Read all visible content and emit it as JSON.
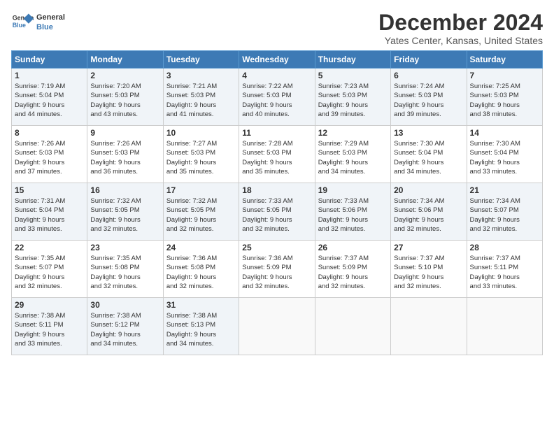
{
  "logo": {
    "name": "General Blue",
    "line1": "General",
    "line2": "Blue"
  },
  "title": "December 2024",
  "location": "Yates Center, Kansas, United States",
  "weekdays": [
    "Sunday",
    "Monday",
    "Tuesday",
    "Wednesday",
    "Thursday",
    "Friday",
    "Saturday"
  ],
  "weeks": [
    [
      {
        "day": "1",
        "sunrise": "7:19 AM",
        "sunset": "5:04 PM",
        "daylight": "9 hours and 44 minutes."
      },
      {
        "day": "2",
        "sunrise": "7:20 AM",
        "sunset": "5:03 PM",
        "daylight": "9 hours and 43 minutes."
      },
      {
        "day": "3",
        "sunrise": "7:21 AM",
        "sunset": "5:03 PM",
        "daylight": "9 hours and 41 minutes."
      },
      {
        "day": "4",
        "sunrise": "7:22 AM",
        "sunset": "5:03 PM",
        "daylight": "9 hours and 40 minutes."
      },
      {
        "day": "5",
        "sunrise": "7:23 AM",
        "sunset": "5:03 PM",
        "daylight": "9 hours and 39 minutes."
      },
      {
        "day": "6",
        "sunrise": "7:24 AM",
        "sunset": "5:03 PM",
        "daylight": "9 hours and 39 minutes."
      },
      {
        "day": "7",
        "sunrise": "7:25 AM",
        "sunset": "5:03 PM",
        "daylight": "9 hours and 38 minutes."
      }
    ],
    [
      {
        "day": "8",
        "sunrise": "7:26 AM",
        "sunset": "5:03 PM",
        "daylight": "9 hours and 37 minutes."
      },
      {
        "day": "9",
        "sunrise": "7:26 AM",
        "sunset": "5:03 PM",
        "daylight": "9 hours and 36 minutes."
      },
      {
        "day": "10",
        "sunrise": "7:27 AM",
        "sunset": "5:03 PM",
        "daylight": "9 hours and 35 minutes."
      },
      {
        "day": "11",
        "sunrise": "7:28 AM",
        "sunset": "5:03 PM",
        "daylight": "9 hours and 35 minutes."
      },
      {
        "day": "12",
        "sunrise": "7:29 AM",
        "sunset": "5:03 PM",
        "daylight": "9 hours and 34 minutes."
      },
      {
        "day": "13",
        "sunrise": "7:30 AM",
        "sunset": "5:04 PM",
        "daylight": "9 hours and 34 minutes."
      },
      {
        "day": "14",
        "sunrise": "7:30 AM",
        "sunset": "5:04 PM",
        "daylight": "9 hours and 33 minutes."
      }
    ],
    [
      {
        "day": "15",
        "sunrise": "7:31 AM",
        "sunset": "5:04 PM",
        "daylight": "9 hours and 33 minutes."
      },
      {
        "day": "16",
        "sunrise": "7:32 AM",
        "sunset": "5:05 PM",
        "daylight": "9 hours and 32 minutes."
      },
      {
        "day": "17",
        "sunrise": "7:32 AM",
        "sunset": "5:05 PM",
        "daylight": "9 hours and 32 minutes."
      },
      {
        "day": "18",
        "sunrise": "7:33 AM",
        "sunset": "5:05 PM",
        "daylight": "9 hours and 32 minutes."
      },
      {
        "day": "19",
        "sunrise": "7:33 AM",
        "sunset": "5:06 PM",
        "daylight": "9 hours and 32 minutes."
      },
      {
        "day": "20",
        "sunrise": "7:34 AM",
        "sunset": "5:06 PM",
        "daylight": "9 hours and 32 minutes."
      },
      {
        "day": "21",
        "sunrise": "7:34 AM",
        "sunset": "5:07 PM",
        "daylight": "9 hours and 32 minutes."
      }
    ],
    [
      {
        "day": "22",
        "sunrise": "7:35 AM",
        "sunset": "5:07 PM",
        "daylight": "9 hours and 32 minutes."
      },
      {
        "day": "23",
        "sunrise": "7:35 AM",
        "sunset": "5:08 PM",
        "daylight": "9 hours and 32 minutes."
      },
      {
        "day": "24",
        "sunrise": "7:36 AM",
        "sunset": "5:08 PM",
        "daylight": "9 hours and 32 minutes."
      },
      {
        "day": "25",
        "sunrise": "7:36 AM",
        "sunset": "5:09 PM",
        "daylight": "9 hours and 32 minutes."
      },
      {
        "day": "26",
        "sunrise": "7:37 AM",
        "sunset": "5:09 PM",
        "daylight": "9 hours and 32 minutes."
      },
      {
        "day": "27",
        "sunrise": "7:37 AM",
        "sunset": "5:10 PM",
        "daylight": "9 hours and 32 minutes."
      },
      {
        "day": "28",
        "sunrise": "7:37 AM",
        "sunset": "5:11 PM",
        "daylight": "9 hours and 33 minutes."
      }
    ],
    [
      {
        "day": "29",
        "sunrise": "7:38 AM",
        "sunset": "5:11 PM",
        "daylight": "9 hours and 33 minutes."
      },
      {
        "day": "30",
        "sunrise": "7:38 AM",
        "sunset": "5:12 PM",
        "daylight": "9 hours and 34 minutes."
      },
      {
        "day": "31",
        "sunrise": "7:38 AM",
        "sunset": "5:13 PM",
        "daylight": "9 hours and 34 minutes."
      },
      null,
      null,
      null,
      null
    ]
  ],
  "labels": {
    "sunrise": "Sunrise:",
    "sunset": "Sunset:",
    "daylight": "Daylight hours"
  }
}
